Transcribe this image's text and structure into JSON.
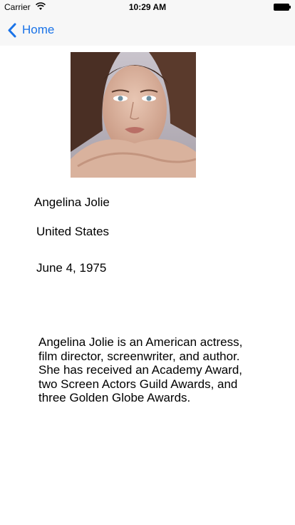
{
  "status_bar": {
    "carrier": "Carrier",
    "time": "10:29 AM"
  },
  "nav": {
    "back_label": "Home"
  },
  "profile": {
    "name": "Angelina Jolie",
    "country": "United States",
    "birthdate": "June 4, 1975",
    "bio": "Angelina Jolie is an American actress, film director, screenwriter, and author. She has received an Academy Award, two Screen Actors Guild Awards, and three Golden Globe Awards."
  },
  "colors": {
    "accent": "#1a73e8",
    "bar_background": "#f7f7f7"
  }
}
